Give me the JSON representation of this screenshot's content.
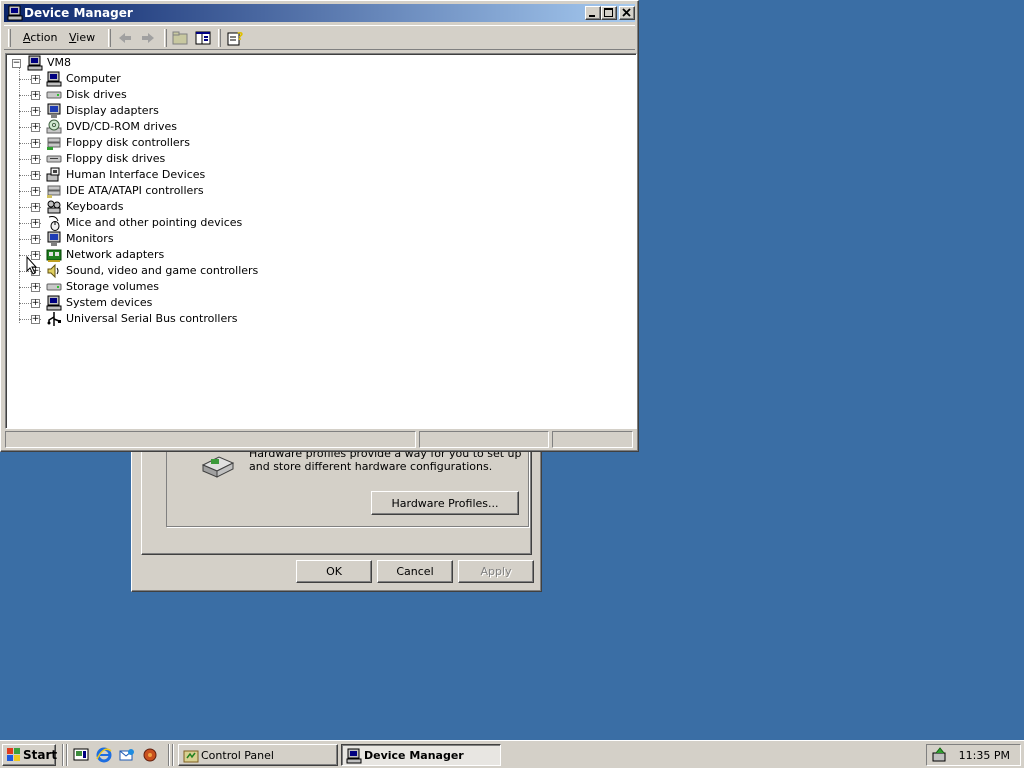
{
  "desktop": {
    "background": "#3a6ea5"
  },
  "system_properties": {
    "hardware_profiles_text": "Hardware profiles provide a way for you to set up and store different hardware configurations.",
    "hardware_profiles_button": "Hardware Profiles...",
    "ok_button": "OK",
    "cancel_button": "Cancel",
    "apply_button": "Apply"
  },
  "device_manager": {
    "title": "Device Manager",
    "menu": [
      {
        "label": "Action",
        "accel": "A",
        "rest": "ction"
      },
      {
        "label": "View",
        "accel": "V",
        "rest": "iew"
      }
    ],
    "toolbar": [
      "back-arrow-icon",
      "forward-arrow-icon",
      "up-folder-icon",
      "show-hide-tree-icon",
      "properties-help-icon"
    ],
    "tree": {
      "root": "VM8",
      "items": [
        {
          "label": "Computer",
          "icon": "computer-icon"
        },
        {
          "label": "Disk drives",
          "icon": "disk-drive-icon"
        },
        {
          "label": "Display adapters",
          "icon": "display-adapter-icon"
        },
        {
          "label": "DVD/CD-ROM drives",
          "icon": "cdrom-icon"
        },
        {
          "label": "Floppy disk controllers",
          "icon": "floppy-controller-icon"
        },
        {
          "label": "Floppy disk drives",
          "icon": "floppy-drive-icon"
        },
        {
          "label": "Human Interface Devices",
          "icon": "hid-icon"
        },
        {
          "label": "IDE ATA/ATAPI controllers",
          "icon": "ide-controller-icon"
        },
        {
          "label": "Keyboards",
          "icon": "keyboard-icon"
        },
        {
          "label": "Mice and other pointing devices",
          "icon": "mouse-icon"
        },
        {
          "label": "Monitors",
          "icon": "monitor-icon"
        },
        {
          "label": "Network adapters",
          "icon": "network-adapter-icon"
        },
        {
          "label": "Sound, video and game controllers",
          "icon": "sound-icon"
        },
        {
          "label": "Storage volumes",
          "icon": "storage-volume-icon"
        },
        {
          "label": "System devices",
          "icon": "system-devices-icon"
        },
        {
          "label": "Universal Serial Bus controllers",
          "icon": "usb-icon"
        }
      ]
    }
  },
  "taskbar": {
    "start_label": "Start",
    "quick_launch": [
      "show-desktop-icon",
      "internet-explorer-icon",
      "outlook-express-icon",
      "media-player-icon"
    ],
    "tasks": [
      {
        "label": "Control Panel",
        "active": false
      },
      {
        "label": "Device Manager",
        "active": true
      }
    ],
    "clock": "11:35 PM"
  }
}
